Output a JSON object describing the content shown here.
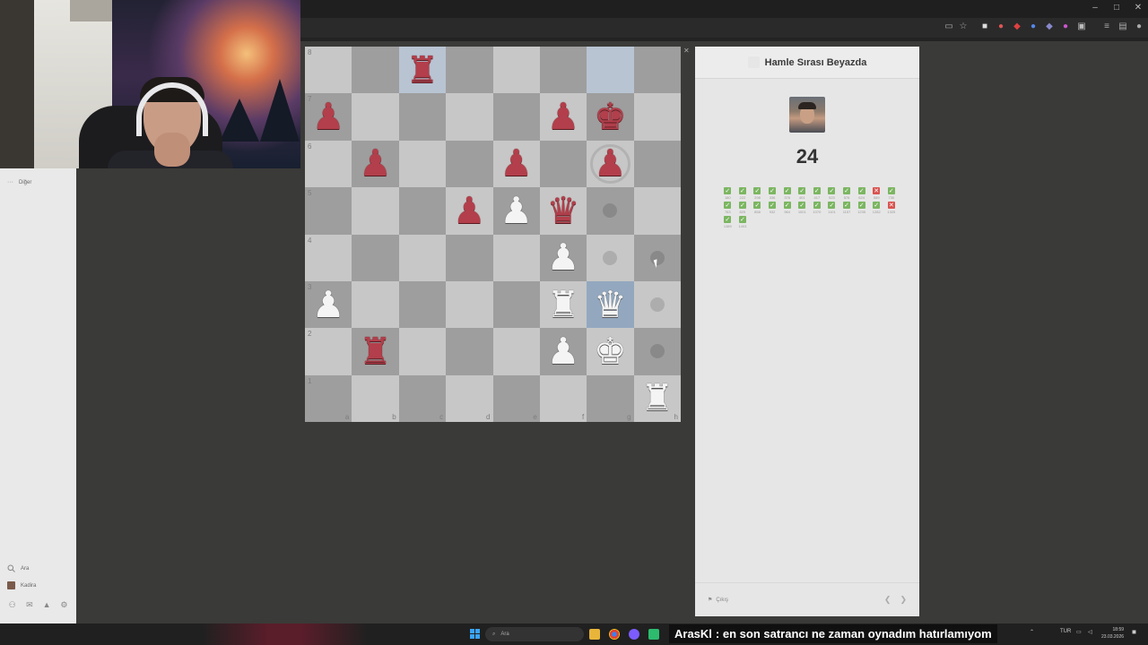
{
  "window": {
    "controls": [
      "–",
      "□",
      "✕"
    ]
  },
  "toolbar_icons": [
    "cast-icon",
    "star-icon",
    "extension-icon",
    "extension-icon",
    "extension-icon",
    "extension-icon",
    "extension-icon",
    "extension-icon",
    "extension-icon",
    "puzzle-icon",
    "bookmark-icon",
    "tab-icon",
    "profile-icon"
  ],
  "sidebar": {
    "more_label": "Diğer",
    "search_label": "Ara",
    "profile_label": "Kadira"
  },
  "board": {
    "rank_labels": [
      "8",
      "7",
      "6",
      "5",
      "4",
      "3",
      "2",
      "1"
    ],
    "file_labels": [
      "a",
      "b",
      "c",
      "d",
      "e",
      "f",
      "g",
      "h"
    ],
    "highlight_squares": [
      "c8",
      "g8",
      "g3"
    ],
    "hint_squares": [
      "g5",
      "g4",
      "h4",
      "h3",
      "h2"
    ],
    "capture_ring_squares": [
      "g6"
    ],
    "pieces": {
      "c8": {
        "type": "rook",
        "color": "red",
        "glyph": "♜"
      },
      "a7": {
        "type": "pawn",
        "color": "red",
        "glyph": "♟"
      },
      "f7": {
        "type": "pawn",
        "color": "red",
        "glyph": "♟"
      },
      "g7": {
        "type": "king",
        "color": "red",
        "glyph": "♚"
      },
      "b6": {
        "type": "pawn",
        "color": "red",
        "glyph": "♟"
      },
      "e6": {
        "type": "pawn",
        "color": "red",
        "glyph": "♟"
      },
      "g6": {
        "type": "pawn",
        "color": "red",
        "glyph": "♟"
      },
      "d5": {
        "type": "pawn",
        "color": "red",
        "glyph": "♟"
      },
      "e5": {
        "type": "pawn",
        "color": "white",
        "glyph": "♟"
      },
      "f5": {
        "type": "queen",
        "color": "red",
        "glyph": "♛"
      },
      "f4": {
        "type": "pawn",
        "color": "white",
        "glyph": "♟"
      },
      "a3": {
        "type": "pawn",
        "color": "white",
        "glyph": "♟"
      },
      "f3": {
        "type": "rook",
        "color": "white",
        "glyph": "♜"
      },
      "g3": {
        "type": "queen",
        "color": "white",
        "glyph": "♛"
      },
      "b2": {
        "type": "rook",
        "color": "red",
        "glyph": "♜"
      },
      "f2": {
        "type": "pawn",
        "color": "white",
        "glyph": "♟"
      },
      "g2": {
        "type": "king",
        "color": "white",
        "glyph": "♚"
      },
      "h1": {
        "type": "rook",
        "color": "white",
        "glyph": "♜"
      }
    }
  },
  "panel": {
    "title": "Hamle Sırası Beyazda",
    "score": "24",
    "exit_label": "Çıkış",
    "results": [
      {
        "ok": true,
        "rating": "180"
      },
      {
        "ok": true,
        "rating": "222"
      },
      {
        "ok": true,
        "rating": "298"
      },
      {
        "ok": true,
        "rating": "336"
      },
      {
        "ok": true,
        "rating": "376"
      },
      {
        "ok": true,
        "rating": "401"
      },
      {
        "ok": true,
        "rating": "417"
      },
      {
        "ok": true,
        "rating": "523"
      },
      {
        "ok": true,
        "rating": "576"
      },
      {
        "ok": true,
        "rating": "624"
      },
      {
        "ok": false,
        "rating": "589"
      },
      {
        "ok": true,
        "rating": "730"
      },
      {
        "ok": true,
        "rating": "763"
      },
      {
        "ok": true,
        "rating": "825"
      },
      {
        "ok": true,
        "rating": "858"
      },
      {
        "ok": true,
        "rating": "932"
      },
      {
        "ok": true,
        "rating": "964"
      },
      {
        "ok": true,
        "rating": "1001"
      },
      {
        "ok": true,
        "rating": "1070"
      },
      {
        "ok": true,
        "rating": "1101"
      },
      {
        "ok": true,
        "rating": "1157"
      },
      {
        "ok": true,
        "rating": "1235"
      },
      {
        "ok": true,
        "rating": "1282"
      },
      {
        "ok": false,
        "rating": "1325"
      },
      {
        "ok": true,
        "rating": "1389"
      },
      {
        "ok": true,
        "rating": "1403"
      }
    ]
  },
  "taskbar": {
    "search_label": "Ara",
    "subtitle_user": "ArasKl",
    "subtitle_text": ": en son satrancı ne zaman oynadım hatırlamıyom",
    "tray_lang": "TUR",
    "time": "18:59",
    "date": "23.03.2026"
  },
  "colors": {
    "board_light": "#c7c7c7",
    "board_dark": "#9e9e9e",
    "highlight": "#93a8bf",
    "red_piece": "#b23f4b",
    "success": "#7bb661",
    "fail": "#d9534f"
  }
}
